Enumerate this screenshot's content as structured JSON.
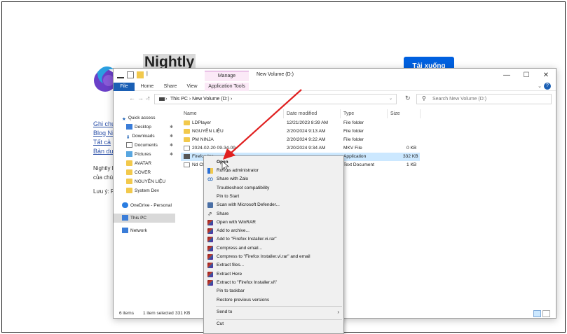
{
  "webpage": {
    "title": "Nightly",
    "download_button": "Tải xuống",
    "links": [
      "Ghi chú",
      "Blog Ni",
      "Tất cả",
      "Bản dụ"
    ],
    "text1": "Nightly l",
    "text2": "của chú",
    "text3": "Lưu ý: Fi"
  },
  "explorer": {
    "manage_tab": "Manage",
    "window_title": "New Volume (D:)",
    "window_controls": [
      "—",
      "☐",
      "✕"
    ],
    "ribbon_tabs": [
      "File",
      "Home",
      "Share",
      "View",
      "Application Tools"
    ],
    "breadcrumb": [
      "This PC",
      "New Volume (D:)"
    ],
    "search_placeholder": "Search New Volume (D:)",
    "columns": [
      "Name",
      "Date modified",
      "Type",
      "Size"
    ],
    "nav": {
      "quick_access": "Quick access",
      "items": [
        "Desktop",
        "Downloads",
        "Documents",
        "Pictures",
        "AVATAR",
        "COVER",
        "NGUYÊN LIỆU",
        "System Dev"
      ],
      "onedrive": "OneDrive - Personal",
      "this_pc": "This PC",
      "network": "Network"
    },
    "files": [
      {
        "name": "LDPlayer",
        "date": "12/21/2023 8:39 AM",
        "type": "File folder",
        "size": ""
      },
      {
        "name": "NGUYÊN LIỆU",
        "date": "2/20/2024 9:13 AM",
        "type": "File folder",
        "size": ""
      },
      {
        "name": "PM NINJA",
        "date": "2/20/2024 9:22 AM",
        "type": "File folder",
        "size": ""
      },
      {
        "name": "2024-02-20 09-34-09",
        "date": "2/20/2024 9:34 AM",
        "type": "MKV File",
        "size": "0 KB"
      },
      {
        "name": "Firefox Ins",
        "date": "",
        "type": "Application",
        "size": "332 KB"
      },
      {
        "name": "Nd Cl",
        "date": "",
        "type": "Text Document",
        "size": "1 KB"
      }
    ],
    "status": {
      "count": "6 items",
      "selected": "1 item selected",
      "size": "331 KB"
    }
  },
  "context_menu": {
    "items": [
      "Open",
      "Run as administrator",
      "Share with Zalo",
      "Troubleshoot compatibility",
      "Pin to Start",
      "Scan with Microsoft Defender...",
      "Share",
      "Open with WinRAR",
      "Add to archive...",
      "Add to \"Firefox Installer.vi.rar\"",
      "Compress and email...",
      "Compress to \"Firefox Installer.vi.rar\" and email",
      "Extract files...",
      "Extract Here",
      "Extract to \"Firefox Installer.vi\\\"",
      "Pin to taskbar",
      "Restore previous versions",
      "Send to",
      "Cut"
    ]
  },
  "colors": {
    "accent": "#1a5fb4",
    "selection": "#cce8ff",
    "manage_tab": "#fbe9f7",
    "arrow": "#e02020",
    "download_button": "#0060df"
  }
}
